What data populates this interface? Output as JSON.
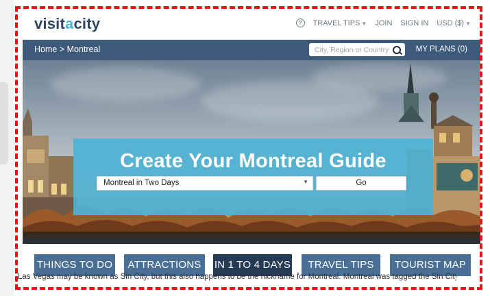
{
  "header": {
    "logo_part1": "visit",
    "logo_part2": "a",
    "logo_part3": "city",
    "nav": {
      "travel_tips": "TRAVEL TIPS",
      "join": "JOIN",
      "sign_in": "SIGN IN",
      "currency": "USD ($)"
    }
  },
  "navbar": {
    "breadcrumb": "Home > Montreal",
    "search_placeholder": "City, Region or Country",
    "my_plans": "MY PLANS (0)"
  },
  "guide": {
    "title": "Create Your Montreal Guide",
    "selected_itinerary": "Montreal in Two Days",
    "go_label": "Go"
  },
  "tabs": [
    {
      "label": "THINGS TO DO"
    },
    {
      "label": "ATTRACTIONS"
    },
    {
      "label": "IN 1 TO 4 DAYS"
    },
    {
      "label": "TRAVEL TIPS"
    },
    {
      "label": "TOURIST MAP"
    }
  ],
  "intro": {
    "text": "Las Vegas may be known as Sin City, but this also happens to be the nickname for Montreal. Montreal was tagged the Sin City back"
  },
  "colors": {
    "brand_dark": "#2e4560",
    "brand_accent": "#4fb3d8",
    "navbar": "#3d5a7a",
    "tab": "#4a6f95",
    "tab_active": "#253a55",
    "frame": "#ee1111"
  }
}
